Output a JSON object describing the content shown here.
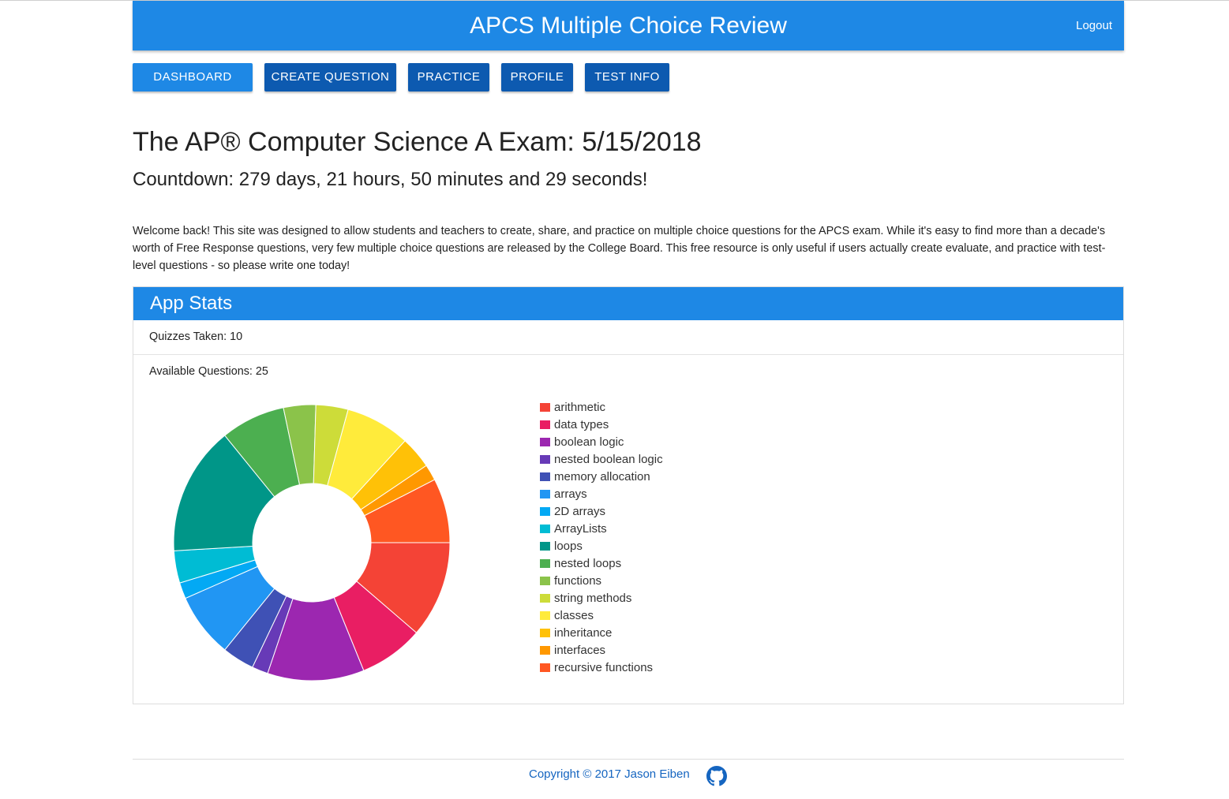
{
  "app": {
    "title": "APCS Multiple Choice Review",
    "logout": "Logout"
  },
  "nav": {
    "items": [
      {
        "label": "DASHBOARD",
        "active": true
      },
      {
        "label": "CREATE QUESTION",
        "active": false
      },
      {
        "label": "PRACTICE",
        "active": false
      },
      {
        "label": "PROFILE",
        "active": false
      },
      {
        "label": "TEST INFO",
        "active": false
      }
    ]
  },
  "main": {
    "exam_title": "The AP® Computer Science A Exam: 5/15/2018",
    "countdown": "Countdown: 279 days, 21 hours, 50 minutes and 29 seconds!",
    "welcome": "Welcome back! This site was designed to allow students and teachers to create, share, and practice on multiple choice questions for the APCS exam. While it's easy to find more than a decade's worth of Free Response questions, very few multiple choice questions are released by the College Board. This free resource is only useful if users actually create evaluate, and practice with test-level questions - so please write one today!"
  },
  "stats": {
    "title": "App Stats",
    "quizzes": "Quizzes Taken: 10",
    "questions": "Available Questions: 25"
  },
  "chart_data": {
    "type": "pie",
    "donut": true,
    "legend_position": "right",
    "categories": [
      "arithmetic",
      "data types",
      "boolean logic",
      "nested boolean logic",
      "memory allocation",
      "arrays",
      "2D arrays",
      "ArrayLists",
      "loops",
      "nested loops",
      "functions",
      "string methods",
      "classes",
      "inheritance",
      "interfaces",
      "recursive functions"
    ],
    "values": [
      3,
      2,
      3,
      0.5,
      1,
      2,
      0.5,
      1,
      4,
      2,
      1,
      1,
      2,
      1,
      0.5,
      2
    ],
    "colors": [
      "#f44336",
      "#e91e63",
      "#9c27b0",
      "#673ab7",
      "#3f51b5",
      "#2196f3",
      "#03a9f4",
      "#00bcd4",
      "#009688",
      "#4caf50",
      "#8bc34a",
      "#cddc39",
      "#ffeb3b",
      "#ffc107",
      "#ff9800",
      "#ff5722"
    ]
  },
  "footer": {
    "copyright": "Copyright © 2017 Jason Eiben",
    "github_icon": "github-icon"
  },
  "colors": {
    "primary": "#1e88e5",
    "nav_button": "#0d5ab0",
    "link": "#1565c0"
  }
}
